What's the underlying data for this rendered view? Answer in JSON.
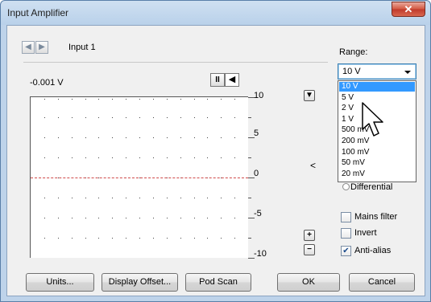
{
  "window": {
    "title": "Input Amplifier",
    "close_glyph": "✕"
  },
  "header": {
    "input_label": "Input 1",
    "prev_icon": "arrow-left-icon",
    "next_icon": "arrow-right-icon"
  },
  "readout": {
    "value": "-0.001 V"
  },
  "plot": {
    "y_labels": [
      "10",
      "5",
      "0",
      "-5",
      "-10"
    ],
    "zero_line_color": "#d04a4a"
  },
  "side_markers": {
    "less_than": "<"
  },
  "range": {
    "label": "Range:",
    "selected": "10 V",
    "options": [
      "10 V",
      "5 V",
      "2 V",
      "1 V",
      "500 mV",
      "200 mV",
      "100 mV",
      "50 mV",
      "20 mV"
    ],
    "highlight_color": "#3399ff"
  },
  "coupling": {
    "partial_label": "Differential"
  },
  "checks": [
    {
      "label": "Mains filter",
      "checked": false
    },
    {
      "label": "Invert",
      "checked": false
    },
    {
      "label": "Anti-alias",
      "checked": true
    }
  ],
  "buttons": {
    "units": "Units...",
    "display_offset": "Display Offset...",
    "pod_scan": "Pod Scan",
    "ok": "OK",
    "cancel": "Cancel"
  }
}
